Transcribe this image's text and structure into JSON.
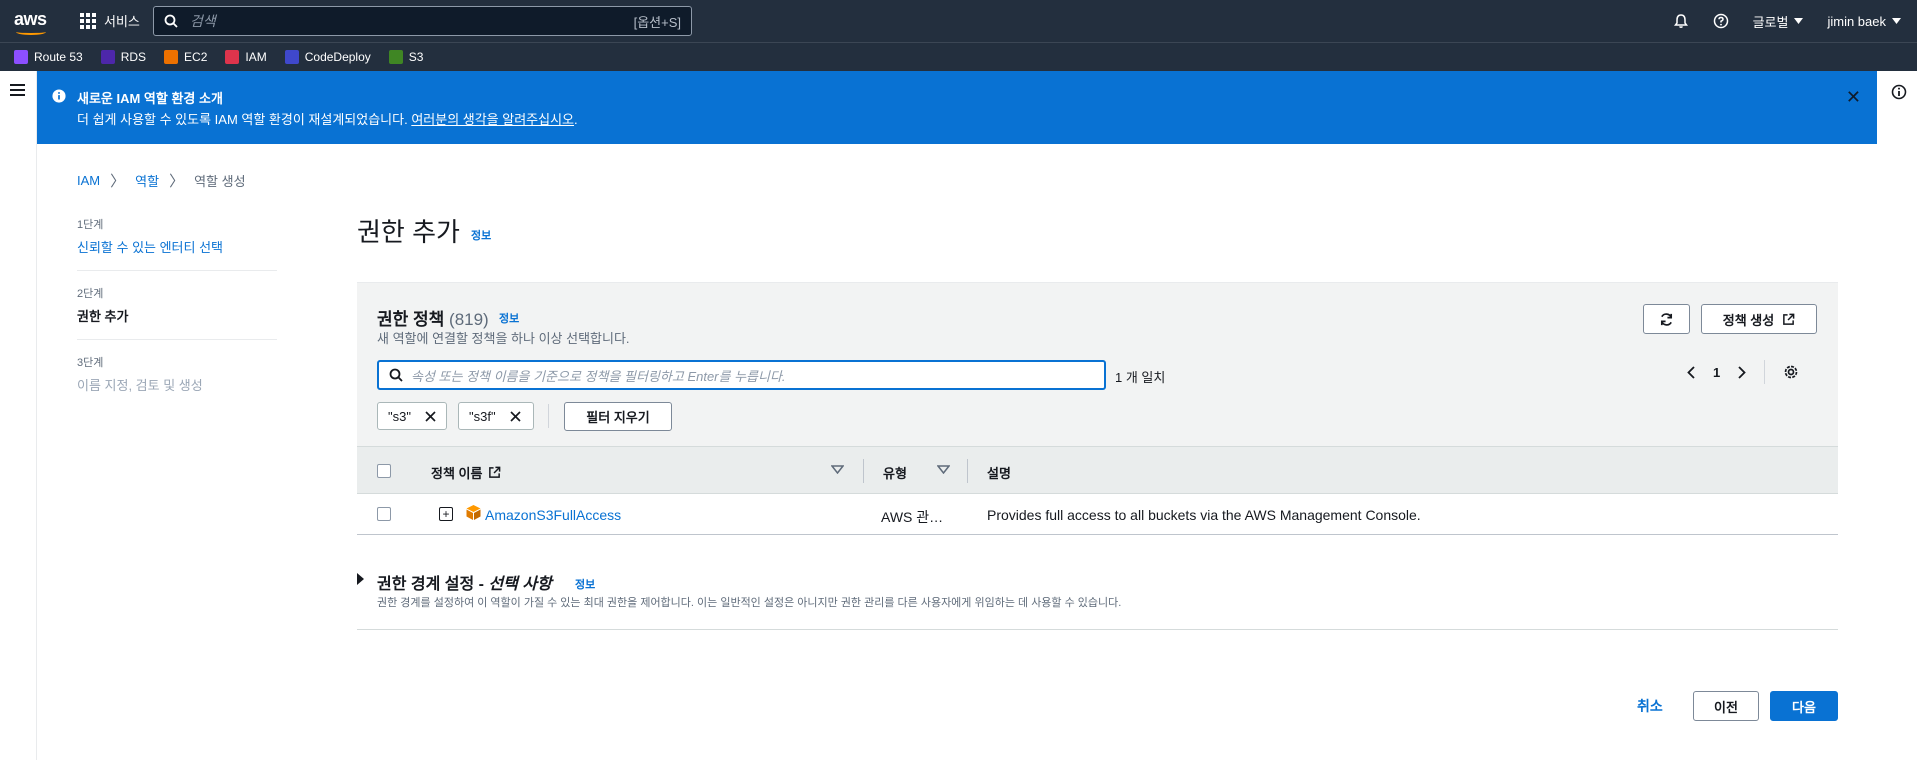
{
  "topnav": {
    "logo": "aws",
    "services_label": "서비스",
    "search_placeholder": "검색",
    "search_shortcut": "[옵션+S]",
    "region_label": "글로벌",
    "user_label": "jimin baek"
  },
  "favorites": [
    {
      "label": "Route 53",
      "color": "#8c4fff"
    },
    {
      "label": "RDS",
      "color": "#4d27aa"
    },
    {
      "label": "EC2",
      "color": "#ed7100"
    },
    {
      "label": "IAM",
      "color": "#dd344c"
    },
    {
      "label": "CodeDeploy",
      "color": "#3f48cc"
    },
    {
      "label": "S3",
      "color": "#3f8624"
    }
  ],
  "flash": {
    "title": "새로운 IAM 역할 환경 소개",
    "body": "더 쉽게 사용할 수 있도록 IAM 역할 환경이 재설계되었습니다. ",
    "link": "여러분의 생각을 알려주십시오",
    "suffix": "."
  },
  "breadcrumb": {
    "items": [
      "IAM",
      "역할",
      "역할 생성"
    ]
  },
  "steps": [
    {
      "number": "1단계",
      "label": "신뢰할 수 있는 엔터티 선택",
      "state": "done"
    },
    {
      "number": "2단계",
      "label": "권한 추가",
      "state": "active"
    },
    {
      "number": "3단계",
      "label": "이름 지정, 검토 및 생성",
      "state": "todo"
    }
  ],
  "page": {
    "title": "권한 추가",
    "info": "정보"
  },
  "policies": {
    "title": "권한 정책",
    "count": "(819)",
    "info": "정보",
    "description": "새 역할에 연결할 정책을 하나 이상 선택합니다.",
    "create_button": "정책 생성",
    "filter_placeholder": "속성 또는 정책 이름을 기준으로 정책을 필터링하고 Enter를 누릅니다.",
    "match_text": "1 개 일치",
    "current_page": "1",
    "tokens": [
      "\"s3\"",
      "\"s3f\""
    ],
    "clear_filters": "필터 지우기",
    "columns": {
      "name": "정책 이름",
      "type": "유형",
      "description": "설명"
    },
    "rows": [
      {
        "name": "AmazonS3FullAccess",
        "type": "AWS 관…",
        "description": "Provides full access to all buckets via the AWS Management Console."
      }
    ]
  },
  "boundary": {
    "title_prefix": "권한 경계 설정 - ",
    "title_optional": "선택 사항",
    "info": "정보",
    "description": "권한 경계를 설정하여 이 역할이 가질 수 있는 최대 권한을 제어합니다. 이는 일반적인 설정은 아니지만 권한 관리를 다른 사용자에게 위임하는 데 사용할 수 있습니다."
  },
  "footer": {
    "cancel": "취소",
    "previous": "이전",
    "next": "다음"
  }
}
